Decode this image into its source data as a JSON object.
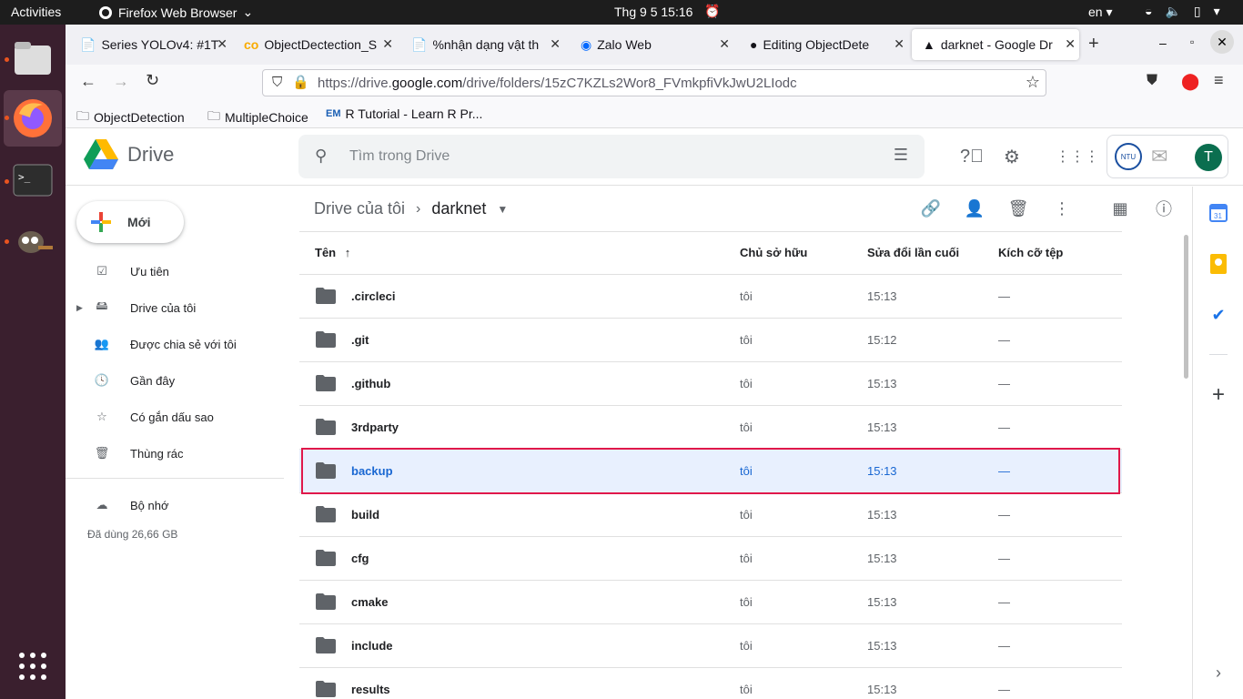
{
  "topbar": {
    "activities": "Activities",
    "app_name": "Firefox Web Browser",
    "clock": "Thg 9 5  15:16",
    "lang": "en"
  },
  "browser": {
    "tabs": [
      {
        "label": "Series YOLOv4: #1T"
      },
      {
        "label": "ObjectDectection_S"
      },
      {
        "label": "%nhận dạng vật th"
      },
      {
        "label": "Zalo Web"
      },
      {
        "label": "Editing ObjectDete"
      },
      {
        "label": "darknet - Google Dr"
      }
    ],
    "url_prefix": "https://drive.",
    "url_domain": "google.com",
    "url_path": "/drive/folders/15zC7KZLs2Wor8_FVmkpfiVkJwU2LIodc",
    "bookmarks": [
      "ObjectDetection",
      "MultipleChoice",
      "R Tutorial - Learn R Pr..."
    ]
  },
  "drive": {
    "logo_text": "Drive",
    "search_placeholder": "Tìm trong Drive",
    "avatar_letter": "T",
    "new_button": "Mới",
    "sidebar": [
      {
        "label": "Ưu tiên"
      },
      {
        "label": "Drive của tôi"
      },
      {
        "label": "Được chia sẻ với tôi"
      },
      {
        "label": "Gần đây"
      },
      {
        "label": "Có gắn dấu sao"
      },
      {
        "label": "Thùng rác"
      }
    ],
    "storage_label": "Bộ nhớ",
    "storage_used": "Đã dùng 26,66 GB",
    "breadcrumb_root": "Drive của tôi",
    "breadcrumb_current": "darknet",
    "columns": {
      "name": "Tên",
      "owner": "Chủ sở hữu",
      "modified": "Sửa đổi lần cuối",
      "size": "Kích cỡ tệp"
    },
    "files": [
      {
        "name": ".circleci",
        "owner": "tôi",
        "modified": "15:13",
        "size": "—"
      },
      {
        "name": ".git",
        "owner": "tôi",
        "modified": "15:12",
        "size": "—"
      },
      {
        "name": ".github",
        "owner": "tôi",
        "modified": "15:13",
        "size": "—"
      },
      {
        "name": "3rdparty",
        "owner": "tôi",
        "modified": "15:13",
        "size": "—"
      },
      {
        "name": "backup",
        "owner": "tôi",
        "modified": "15:13",
        "size": "—"
      },
      {
        "name": "build",
        "owner": "tôi",
        "modified": "15:13",
        "size": "—"
      },
      {
        "name": "cfg",
        "owner": "tôi",
        "modified": "15:13",
        "size": "—"
      },
      {
        "name": "cmake",
        "owner": "tôi",
        "modified": "15:13",
        "size": "—"
      },
      {
        "name": "include",
        "owner": "tôi",
        "modified": "15:13",
        "size": "—"
      },
      {
        "name": "results",
        "owner": "tôi",
        "modified": "15:13",
        "size": "—"
      }
    ],
    "colors": {
      "accent": "#1967d2",
      "selected_row": "#e8f0fe",
      "highlight_box": "#e0184a"
    }
  }
}
